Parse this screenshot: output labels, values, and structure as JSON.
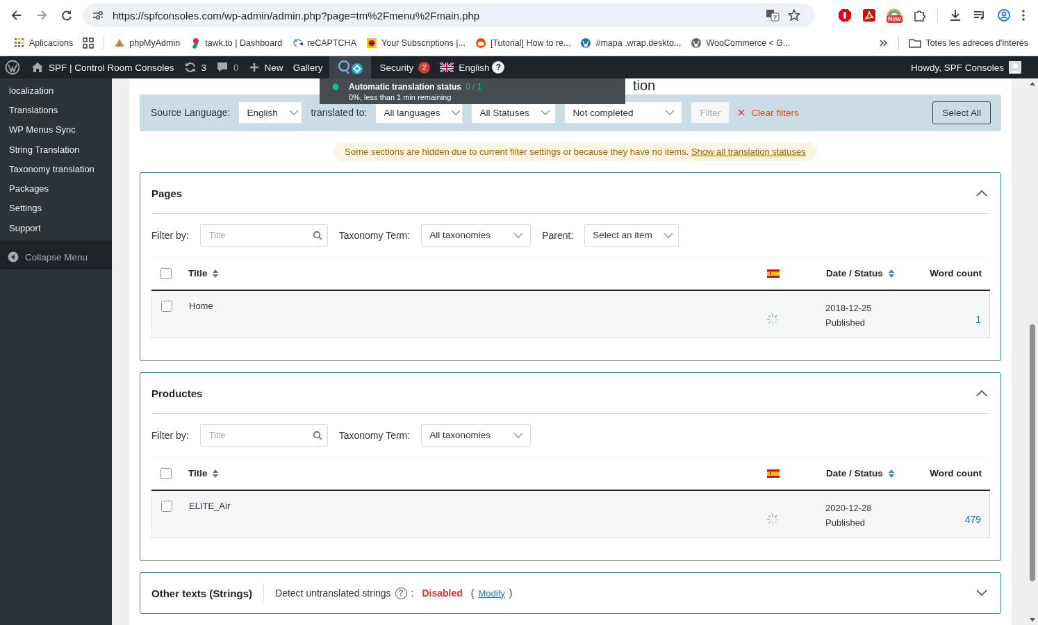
{
  "browser": {
    "url": "https://spfconsoles.com/wp-admin/admin.php?page=tm%2Fmenu%2Fmain.php",
    "bookmarks": [
      {
        "label": "Aplicacions",
        "kind": "apps"
      },
      {
        "label": "phpMyAdmin",
        "kind": "pma"
      },
      {
        "label": "tawk.to | Dashboard",
        "kind": "tawk"
      },
      {
        "label": "reCAPTCHA",
        "kind": "recaptcha"
      },
      {
        "label": "Your Subscriptions |...",
        "kind": "subs"
      },
      {
        "label": "[Tutorial] How to re...",
        "kind": "reddit"
      },
      {
        "label": "#mapa .wrap.deskto...",
        "kind": "wp"
      },
      {
        "label": "WooCommerce < G...",
        "kind": "wpgrey"
      }
    ],
    "all_bookmarks": "Totes les adreces d'interès",
    "extension_badge": "New"
  },
  "admin_bar": {
    "site_name": "SPF | Control Room Consoles",
    "updates": "3",
    "comments": "0",
    "new": "New",
    "gallery": "Gallery",
    "security": "Security",
    "security_count": "2",
    "language": "English",
    "help": "?",
    "howdy": "Howdy, SPF Consoles"
  },
  "tooltip": {
    "title": "Automatic translation status",
    "count": "0 / 1",
    "detail": "0%, less than 1 min remaining"
  },
  "sidebar": {
    "items": [
      "localization",
      "Translations",
      "WP Menus Sync",
      "String Translation",
      "Taxonomy translation",
      "Packages",
      "Settings",
      "Support"
    ],
    "collapse": "Collapse Menu"
  },
  "heading_fragment": "tion",
  "filters": {
    "source_label": "Source Language:",
    "source_value": "English",
    "translated_label": "translated to:",
    "dropdowns": [
      "All languages",
      "All Statuses",
      "Not completed"
    ],
    "filter_button": "Filter",
    "filter_disabled": true,
    "clear": "Clear filters",
    "select_all": "Select All"
  },
  "notice": {
    "text": "Some sections are hidden due to current filter settings or because they have no items.",
    "link": "Show all translation statuses"
  },
  "sections": [
    {
      "title": "Pages",
      "expanded": true,
      "all_checked": false,
      "filter_label": "Filter by:",
      "search_placeholder": "Title",
      "taxonomy_label": "Taxonomy Term:",
      "taxonomy_value": "All taxonomies",
      "parent_label": "Parent:",
      "parent_value": "Select an item",
      "columns": [
        {
          "kind": "title",
          "label": "Title",
          "sorted": false
        },
        {
          "kind": "flag"
        },
        {
          "kind": "date",
          "label": "Date / Status",
          "sorted": true
        },
        {
          "kind": "words",
          "label": "Word count"
        }
      ],
      "rows": [
        {
          "checked": false,
          "title": "Home",
          "date": "2018-12-25",
          "status": "Published",
          "words": "1"
        }
      ]
    },
    {
      "title": "Productes",
      "expanded": true,
      "all_checked": false,
      "filter_label": "Filter by:",
      "search_placeholder": "Title",
      "taxonomy_label": "Taxonomy Term:",
      "taxonomy_value": "All taxonomies",
      "columns": [
        {
          "kind": "title",
          "label": "Title",
          "sorted": false
        },
        {
          "kind": "flag"
        },
        {
          "kind": "date",
          "label": "Date / Status",
          "sorted": true
        },
        {
          "kind": "words",
          "label": "Word count"
        }
      ],
      "rows": [
        {
          "checked": false,
          "title": "ELITE_Air",
          "date": "2020-12-28",
          "status": "Published",
          "words": "479"
        }
      ]
    }
  ],
  "other_texts": {
    "title": "Other texts (Strings)",
    "detect_label": "Detect untranslated strings",
    "help": "?",
    "colon": ":",
    "status": "Disabled",
    "modify_open": "(",
    "modify": "Modify",
    "modify_close": ")",
    "expanded": false
  }
}
